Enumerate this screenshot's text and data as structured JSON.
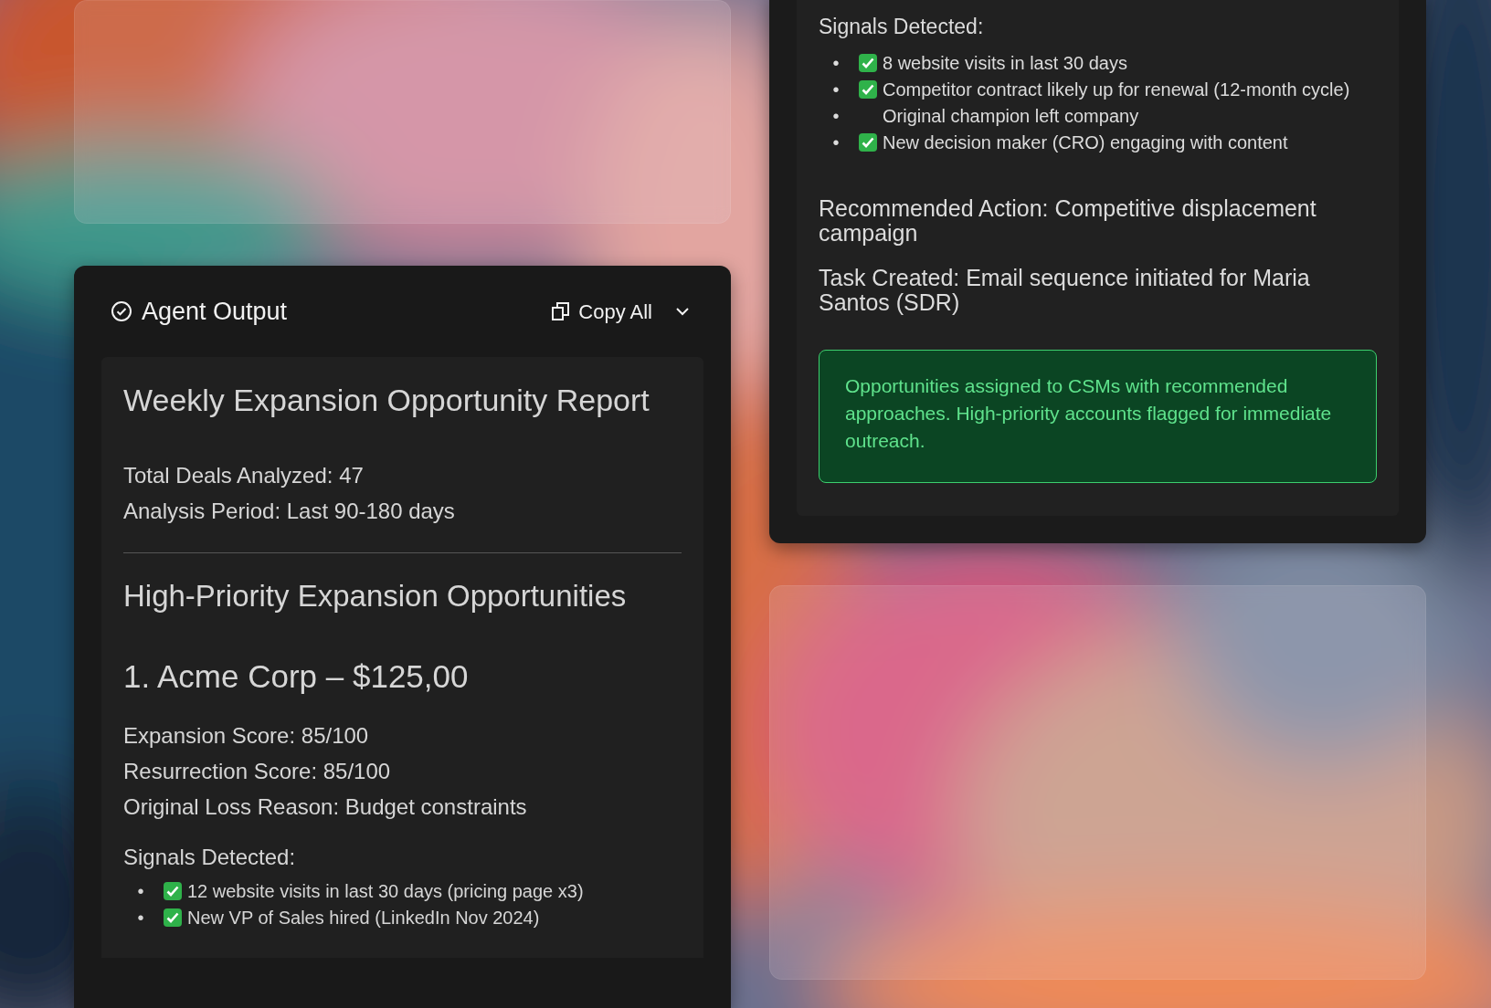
{
  "right_panel": {
    "signals_title": "Signals Detected:",
    "bullet": "•",
    "signals": [
      {
        "text": "8 website visits in last 30 days",
        "checked": true
      },
      {
        "text": "Competitor contract likely up for renewal (12-month cycle)",
        "checked": true
      },
      {
        "text": "Original champion left company",
        "checked": false
      },
      {
        "text": "New decision maker (CRO) engaging with content",
        "checked": true
      }
    ],
    "recommended_action": "Recommended Action: Competitive displacement campaign",
    "task_created": "Task Created: Email sequence initiated for Maria Santos (SDR)",
    "notice": "Opportunities assigned to CSMs with recommended approaches. High-priority accounts flagged for immediate outreach."
  },
  "agent_output": {
    "title": "Agent Output",
    "copy_button": "Copy All",
    "report": {
      "title": "Weekly Expansion Opportunity Report",
      "stats": [
        "Total Deals Analyzed: 47",
        "Analysis Period: Last 90-180 days"
      ],
      "section_title": "High-Priority Expansion Opportunities",
      "accounts": [
        {
          "heading": "1. Acme Corp – $125,00",
          "details": [
            "Expansion Score: 85/100",
            "Resurrection Score: 85/100",
            "Original Loss Reason: Budget constraints"
          ],
          "signals_title": "Signals Detected:",
          "bullet": "•",
          "signals": [
            {
              "text": "12 website visits in last 30 days (pricing page x3)",
              "checked": true
            },
            {
              "text": "New VP of Sales hired (LinkedIn Nov 2024)",
              "checked": true
            }
          ]
        }
      ]
    }
  }
}
